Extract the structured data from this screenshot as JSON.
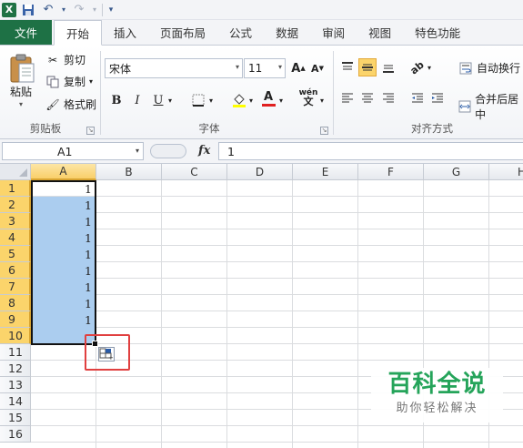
{
  "quick_access": {
    "logo_letter": "X"
  },
  "tabs": [
    {
      "label": "文件"
    },
    {
      "label": "开始"
    },
    {
      "label": "插入"
    },
    {
      "label": "页面布局"
    },
    {
      "label": "公式"
    },
    {
      "label": "数据"
    },
    {
      "label": "审阅"
    },
    {
      "label": "视图"
    },
    {
      "label": "特色功能"
    }
  ],
  "ribbon": {
    "clipboard": {
      "paste": "粘贴",
      "cut": "剪切",
      "copy": "复制",
      "format_painter": "格式刷",
      "group_label": "剪贴板"
    },
    "font": {
      "font_name": "宋体",
      "font_size": "11",
      "grow": "A",
      "shrink": "A",
      "bold": "B",
      "italic": "I",
      "underline": "U",
      "font_color_glyph": "A",
      "wen": "wén",
      "group_label": "字体"
    },
    "alignment": {
      "wrap_text": "自动换行",
      "merge_center": "合并后居中",
      "group_label": "对齐方式"
    }
  },
  "formula_bar": {
    "name_box": "A1",
    "fx": "fx",
    "value": "1"
  },
  "sheet": {
    "columns": [
      "A",
      "B",
      "C",
      "D",
      "E",
      "F",
      "G",
      "H"
    ],
    "rows": [
      "1",
      "2",
      "3",
      "4",
      "5",
      "6",
      "7",
      "8",
      "9",
      "10",
      "11",
      "12",
      "13",
      "14",
      "15",
      "16"
    ],
    "selected_column": "A",
    "selected_rows": [
      "1",
      "2",
      "3",
      "4",
      "5",
      "6",
      "7",
      "8",
      "9",
      "10"
    ],
    "column_a_values": [
      "1",
      "1",
      "1",
      "1",
      "1",
      "1",
      "1",
      "1",
      "1",
      ""
    ]
  },
  "colors": {
    "file_tab": "#1e7145",
    "selection_fill": "#abcdef",
    "header_highlight": "#fbd46b",
    "annotation": "#e04040",
    "watermark": "#25a45a"
  },
  "watermark": {
    "title": "百科全说",
    "subtitle": "助你轻松解决"
  }
}
